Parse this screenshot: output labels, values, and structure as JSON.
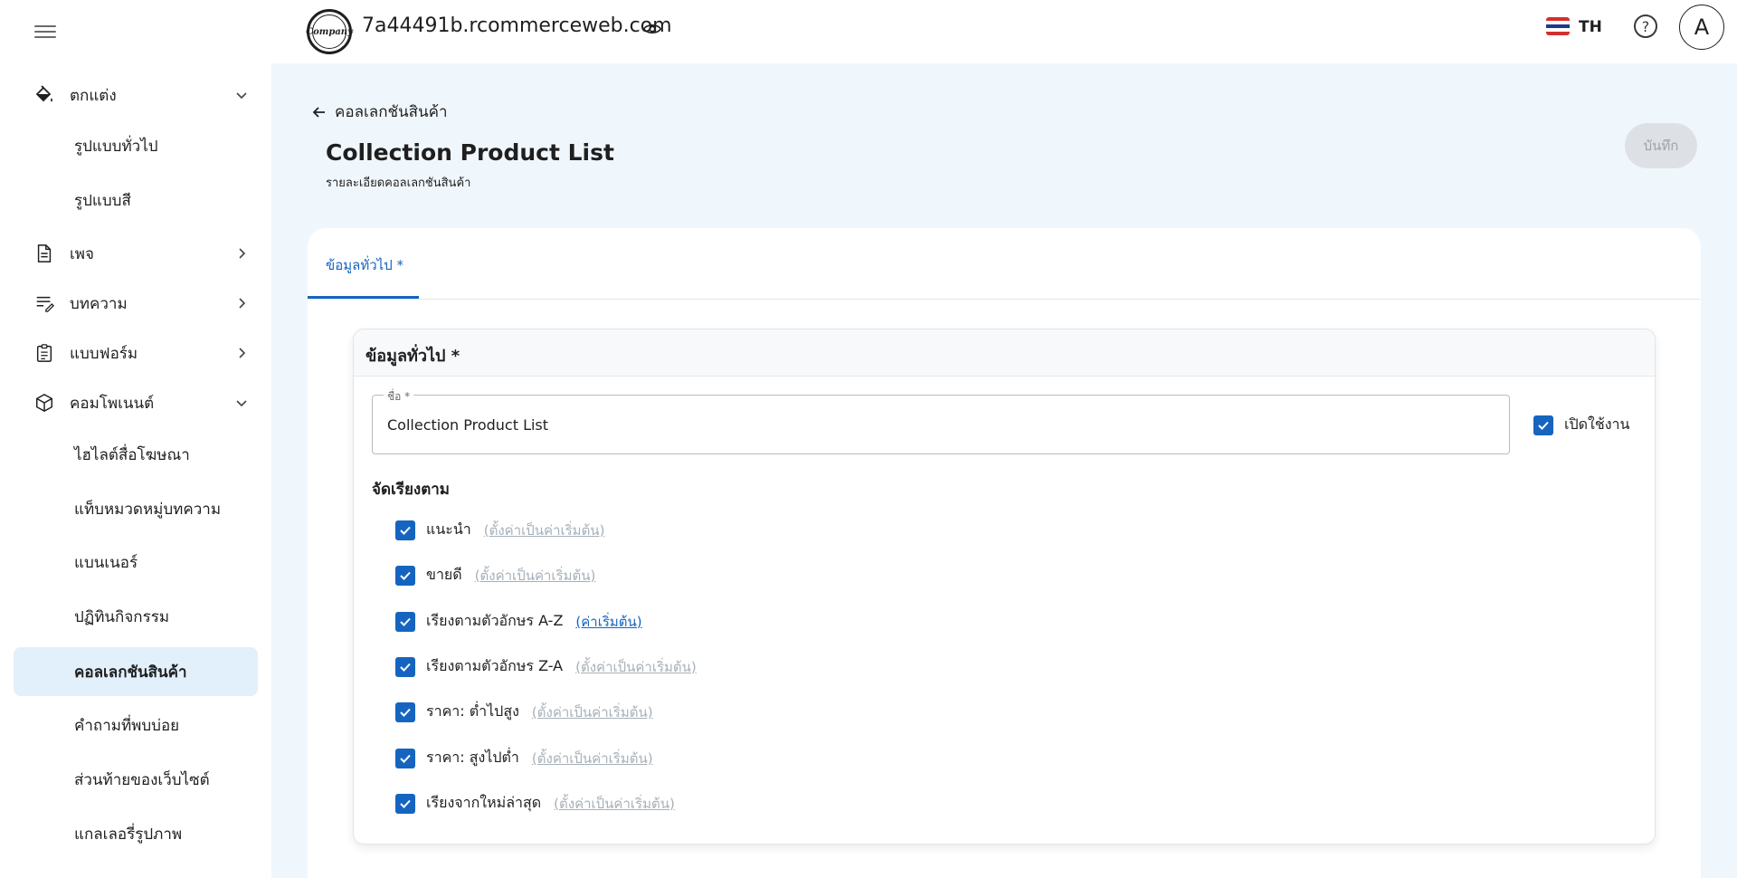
{
  "topbar": {
    "logo_text": "Company",
    "site_url": "7a44491b.rcommerceweb.com",
    "language": "TH",
    "help_symbol": "?",
    "avatar_initial": "A"
  },
  "sidebar": {
    "items": [
      {
        "label": "ตกแต่ง",
        "icon": "paint-bucket-icon",
        "expanded": true
      },
      {
        "label": "รูปแบบทั่วไป"
      },
      {
        "label": "รูปแบบสี"
      },
      {
        "label": "เพจ",
        "icon": "page-icon"
      },
      {
        "label": "บทความ",
        "icon": "article-icon"
      },
      {
        "label": "แบบฟอร์ม",
        "icon": "form-icon"
      },
      {
        "label": "คอมโพเนนต์",
        "icon": "cube-icon",
        "expanded": true
      },
      {
        "label": "ไฮไลต์สื่อโฆษณา"
      },
      {
        "label": "แท็บหมวดหมู่บทความ"
      },
      {
        "label": "แบนเนอร์"
      },
      {
        "label": "ปฏิทินกิจกรรม"
      },
      {
        "label": "คอลเลกชันสินค้า",
        "active": true
      },
      {
        "label": "คำถามที่พบบ่อย"
      },
      {
        "label": "ส่วนท้ายของเว็บไซต์"
      },
      {
        "label": "แกลเลอรี่รูปภาพ"
      }
    ]
  },
  "header": {
    "back_label": "คอลเลกชันสินค้า",
    "title": "Collection Product List",
    "subtitle": "รายละเอียดคอลเลกชันสินค้า",
    "save_label": "บันทึก"
  },
  "tabs": [
    {
      "label": "ข้อมูลทั่วไป *",
      "active": true
    }
  ],
  "form": {
    "section_title": "ข้อมูลทั่วไป *",
    "name_label": "ชื่อ *",
    "name_value": "Collection Product List",
    "enabled_label": "เปิดใช้งาน",
    "enabled": true,
    "sort_title": "จัดเรียงตาม",
    "sort_options": [
      {
        "label": "แนะนำ",
        "link": "(ตั้งค่าเป็นค่าเริ่มต้น)",
        "checked": true,
        "is_default": false
      },
      {
        "label": "ขายดี",
        "link": "(ตั้งค่าเป็นค่าเริ่มต้น)",
        "checked": true,
        "is_default": false
      },
      {
        "label": "เรียงตามตัวอักษร A-Z",
        "link": "(ค่าเริ่มต้น)",
        "checked": true,
        "is_default": true
      },
      {
        "label": "เรียงตามตัวอักษร Z-A",
        "link": "(ตั้งค่าเป็นค่าเริ่มต้น)",
        "checked": true,
        "is_default": false
      },
      {
        "label": "ราคา: ต่ำไปสูง",
        "link": "(ตั้งค่าเป็นค่าเริ่มต้น)",
        "checked": true,
        "is_default": false
      },
      {
        "label": "ราคา: สูงไปต่ำ",
        "link": "(ตั้งค่าเป็นค่าเริ่มต้น)",
        "checked": true,
        "is_default": false
      },
      {
        "label": "เรียงจากใหม่ล่าสุด",
        "link": "(ตั้งค่าเป็นค่าเริ่มต้น)",
        "checked": true,
        "is_default": false
      }
    ]
  },
  "colors": {
    "accent": "#1565c0",
    "active_nav_bg": "#e1f0fb",
    "page_bg": "#f0f7fc"
  }
}
